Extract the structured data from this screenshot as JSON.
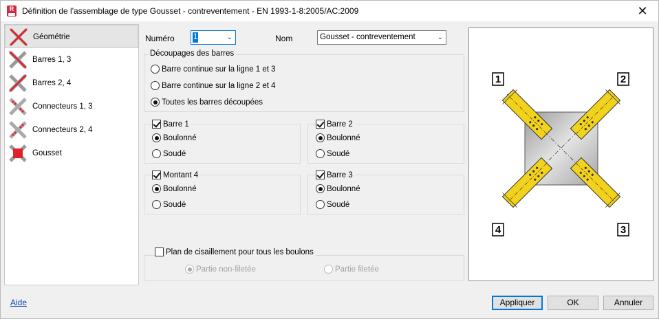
{
  "window": {
    "title": "Définition de l'assemblage de type Gousset - contreventement  - EN 1993-1-8:2005/AC:2009",
    "app_icon_letter": "R"
  },
  "sidebar": {
    "items": [
      {
        "label": "Géométrie",
        "icon": "geometry-icon",
        "selected": true
      },
      {
        "label": "Barres 1, 3",
        "icon": "bars-1-3-icon",
        "selected": false
      },
      {
        "label": "Barres 2, 4",
        "icon": "bars-2-4-icon",
        "selected": false
      },
      {
        "label": "Connecteurs 1, 3",
        "icon": "connectors-1-3-icon",
        "selected": false
      },
      {
        "label": "Connecteurs 2, 4",
        "icon": "connectors-2-4-icon",
        "selected": false
      },
      {
        "label": "Gousset",
        "icon": "gusset-icon",
        "selected": false
      }
    ]
  },
  "form": {
    "numero_label": "Numéro",
    "numero_value": "1",
    "nom_label": "Nom",
    "nom_value": "Gousset - contreventement",
    "decoupages": {
      "title": "Découpages des barres",
      "options": [
        {
          "label": "Barre continue sur la ligne 1 et 3",
          "checked": false
        },
        {
          "label": "Barre continue sur la ligne 2 et 4",
          "checked": false
        },
        {
          "label": "Toutes les barres découpées",
          "checked": true
        }
      ]
    },
    "bars": [
      {
        "label": "Barre 1",
        "checked": true,
        "boulonne": "Boulonné",
        "soude": "Soudé",
        "bolted": true
      },
      {
        "label": "Barre 2",
        "checked": true,
        "boulonne": "Boulonné",
        "soude": "Soudé",
        "bolted": true
      },
      {
        "label": "Montant 4",
        "checked": true,
        "boulonne": "Boulonné",
        "soude": "Soudé",
        "bolted": true
      },
      {
        "label": "Barre 3",
        "checked": true,
        "boulonne": "Boulonné",
        "soude": "Soudé",
        "bolted": true
      }
    ],
    "shear": {
      "label": "Plan de cisaillement pour tous les boulons",
      "checked": false,
      "option1": "Partie non-filetée",
      "option2": "Partie filetée"
    }
  },
  "preview": {
    "labels": [
      "1",
      "2",
      "3",
      "4"
    ],
    "plate_color": "#c8c8c8",
    "bar_color": "#f2d21b"
  },
  "footer": {
    "help": "Aide",
    "apply": "Appliquer",
    "ok": "OK",
    "cancel": "Annuler"
  },
  "colors": {
    "accent": "#0078d7",
    "cross_red": "#e0202a"
  }
}
